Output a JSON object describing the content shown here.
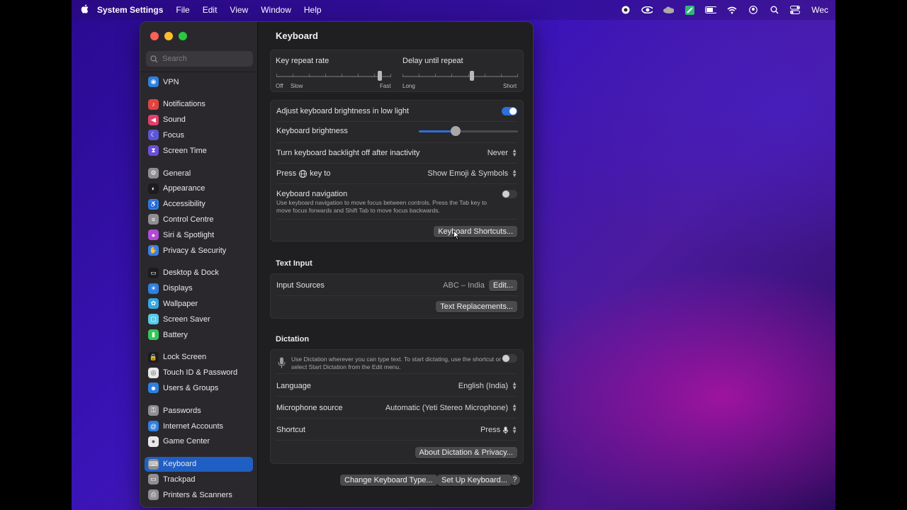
{
  "menubar": {
    "app": "System Settings",
    "menus": [
      "File",
      "Edit",
      "View",
      "Window",
      "Help"
    ],
    "clock": "Wec"
  },
  "search": {
    "placeholder": "Search"
  },
  "sidebar": {
    "items": [
      {
        "label": "VPN",
        "icon": "vpn-icon",
        "color": "#2f7fe0"
      },
      {
        "label": "Notifications",
        "icon": "bell-icon",
        "color": "#e0443f"
      },
      {
        "label": "Sound",
        "icon": "speaker-icon",
        "color": "#e0406a"
      },
      {
        "label": "Focus",
        "icon": "moon-icon",
        "color": "#5b57d6"
      },
      {
        "label": "Screen Time",
        "icon": "hourglass-icon",
        "color": "#6a4fd8"
      },
      {
        "label": "General",
        "icon": "gear-icon",
        "color": "#8e8e93"
      },
      {
        "label": "Appearance",
        "icon": "circle-half-icon",
        "color": "#1c1c1e"
      },
      {
        "label": "Accessibility",
        "icon": "accessibility-icon",
        "color": "#2f7fe0"
      },
      {
        "label": "Control Centre",
        "icon": "switches-icon",
        "color": "#8e8e93"
      },
      {
        "label": "Siri & Spotlight",
        "icon": "siri-icon",
        "color": "#b14bd6"
      },
      {
        "label": "Privacy & Security",
        "icon": "hand-icon",
        "color": "#3b7ee8"
      },
      {
        "label": "Desktop & Dock",
        "icon": "dock-icon",
        "color": "#1c1c1e"
      },
      {
        "label": "Displays",
        "icon": "sun-icon",
        "color": "#2f7fe0"
      },
      {
        "label": "Wallpaper",
        "icon": "flower-icon",
        "color": "#35a7e0"
      },
      {
        "label": "Screen Saver",
        "icon": "screen-saver-icon",
        "color": "#5ac8e8"
      },
      {
        "label": "Battery",
        "icon": "battery-icon",
        "color": "#34c759"
      },
      {
        "label": "Lock Screen",
        "icon": "lock-icon",
        "color": "#1c1c1e"
      },
      {
        "label": "Touch ID & Password",
        "icon": "fingerprint-icon",
        "color": "#e8e8e8"
      },
      {
        "label": "Users & Groups",
        "icon": "users-icon",
        "color": "#2f7fe0"
      },
      {
        "label": "Passwords",
        "icon": "key-icon",
        "color": "#8e8e93"
      },
      {
        "label": "Internet Accounts",
        "icon": "at-icon",
        "color": "#2f7fe0"
      },
      {
        "label": "Game Center",
        "icon": "game-center-icon",
        "color": "#e8e8e8"
      },
      {
        "label": "Keyboard",
        "icon": "keyboard-icon",
        "color": "#8e8e93"
      },
      {
        "label": "Trackpad",
        "icon": "trackpad-icon",
        "color": "#8e8e93"
      },
      {
        "label": "Printers & Scanners",
        "icon": "printer-icon",
        "color": "#8e8e93"
      }
    ],
    "selected": "Keyboard"
  },
  "content": {
    "title": "Keyboard",
    "repeat": {
      "key_repeat_label": "Key repeat rate",
      "key_repeat_ticks": [
        "Off",
        "Slow",
        "Fast"
      ],
      "key_repeat_level": 0.9,
      "delay_label": "Delay until repeat",
      "delay_ticks": [
        "Long",
        "Short"
      ],
      "delay_level": 0.6
    },
    "settings": {
      "adjust_brightness": "Adjust keyboard brightness in low light",
      "adjust_brightness_on": true,
      "brightness_label": "Keyboard brightness",
      "brightness_level": 0.37,
      "backlight_label": "Turn keyboard backlight off after inactivity",
      "backlight_value": "Never",
      "press_key_label_pre": "Press",
      "press_key_label_post": "key to",
      "press_key_value": "Show Emoji & Symbols",
      "nav_label": "Keyboard navigation",
      "nav_desc": "Use keyboard navigation to move focus between controls. Press the Tab key to move focus forwards and Shift Tab to move focus backwards.",
      "nav_on": false,
      "shortcuts_button": "Keyboard Shortcuts..."
    },
    "text_input": {
      "title": "Text Input",
      "sources_label": "Input Sources",
      "sources_value": "ABC – India",
      "edit_button": "Edit...",
      "replacements_button": "Text Replacements..."
    },
    "dictation": {
      "title": "Dictation",
      "desc": "Use Dictation wherever you can type text. To start dictating, use the shortcut or select Start Dictation from the Edit menu.",
      "enabled": false,
      "language_label": "Language",
      "language_value": "English (India)",
      "mic_label": "Microphone source",
      "mic_value": "Automatic (Yeti Stereo Microphone)",
      "shortcut_label": "Shortcut",
      "shortcut_value": "Press",
      "about_button": "About Dictation & Privacy..."
    },
    "footer": {
      "change_type": "Change Keyboard Type...",
      "setup": "Set Up Keyboard...",
      "help": "?"
    }
  }
}
